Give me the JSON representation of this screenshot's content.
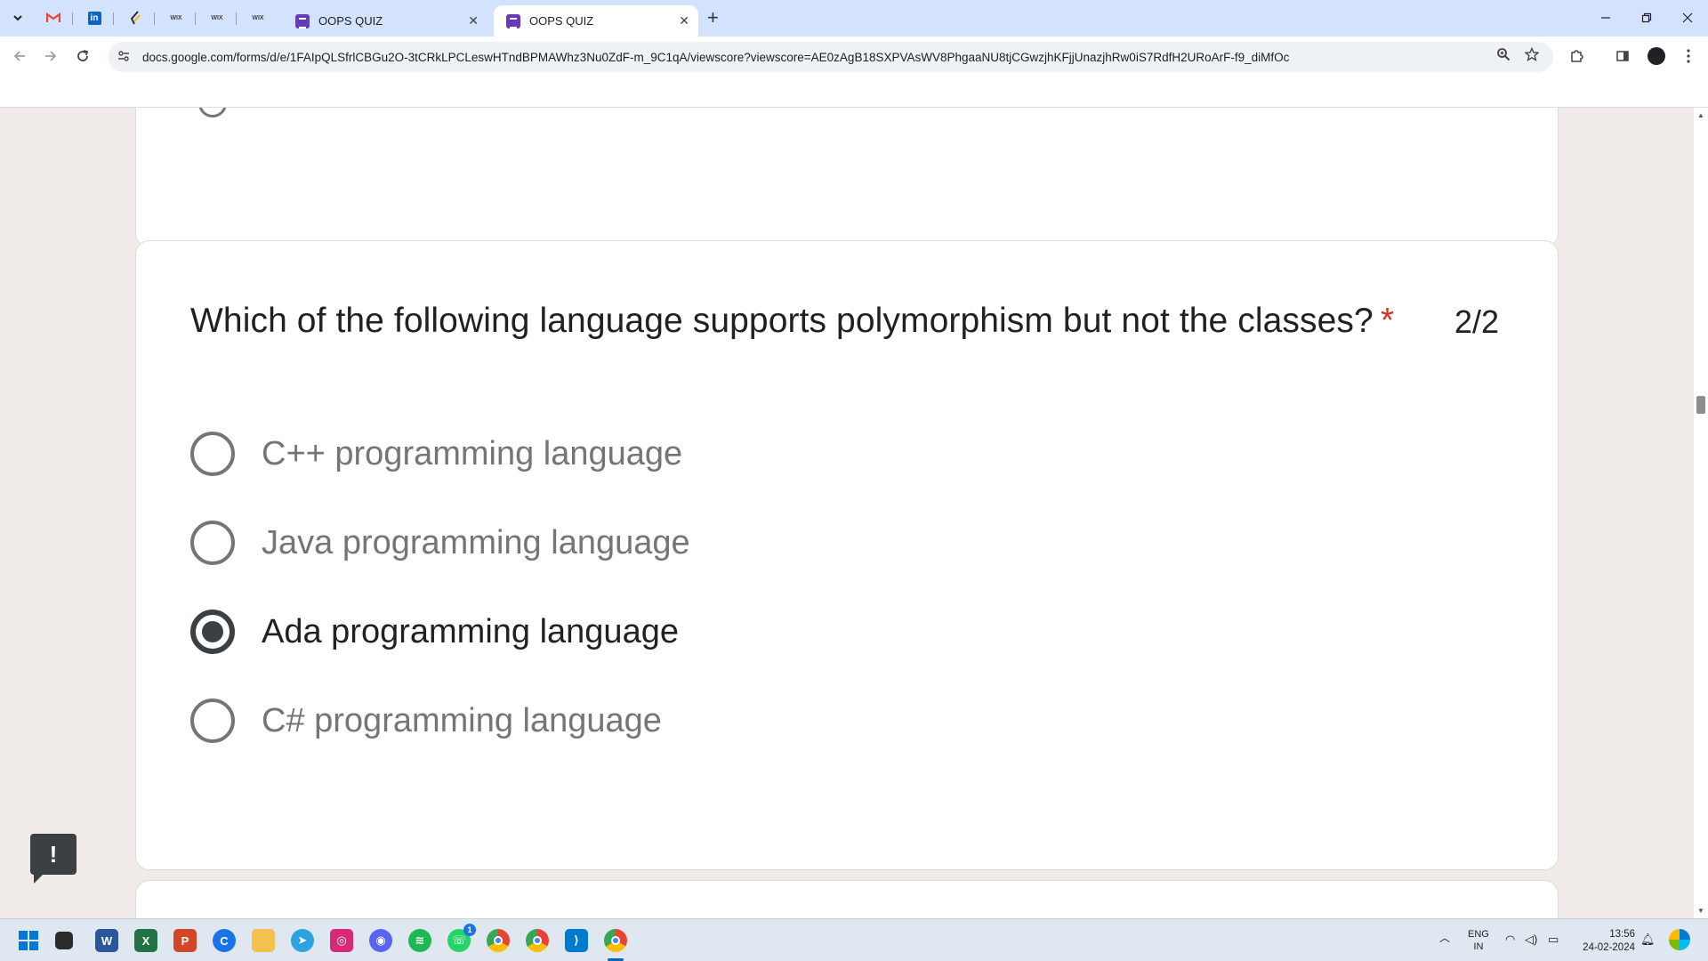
{
  "browser": {
    "tabs": [
      {
        "title": "OOPS QUIZ",
        "active": false
      },
      {
        "title": "OOPS QUIZ",
        "active": true
      }
    ],
    "pinned_tabs": [
      "gmail-icon",
      "linkedin-icon",
      "pen-icon",
      "wix-icon",
      "wix-icon",
      "wix-icon"
    ],
    "pinned_labels": {
      "wix": "WIX"
    },
    "url": "docs.google.com/forms/d/e/1FAIpQLSfrlCBGu2O-3tCRkLPCLeswHTndBPMAWhz3Nu0ZdF-m_9C1qA/viewscore?viewscore=AE0zAgB18SXPVAsWV8PhgaaNU8tjCGwzjhKFjjUnazjhRw0iS7RdfH2URoArF-f9_diMfOc"
  },
  "question": {
    "text": "Which of the following language supports polymorphism but not the classes?",
    "required_mark": "*",
    "score": "2/2",
    "options": [
      {
        "label": "C++ programming language",
        "selected": false
      },
      {
        "label": "Java programming language",
        "selected": false
      },
      {
        "label": "Ada programming language",
        "selected": true
      },
      {
        "label": "C# programming language",
        "selected": false
      }
    ]
  },
  "feedback_button": "!",
  "taskbar": {
    "apps": [
      "windows-start-icon",
      "file-explorer-icon",
      "word-icon",
      "excel-icon",
      "powerpoint-icon",
      "edge-c-icon",
      "folder-icon",
      "telegram-icon",
      "instagram-icon",
      "discord-icon",
      "spotify-icon",
      "whatsapp-icon",
      "chrome-icon",
      "chrome-profile-icon",
      "vscode-icon",
      "chrome-active-icon"
    ],
    "whatsapp_badge": "1",
    "language": "ENG",
    "region": "IN",
    "time": "13:56",
    "date": "24-02-2024"
  },
  "colors": {
    "accent": "#673ab7",
    "required": "#d93025",
    "page_bg": "#f0ebe8"
  }
}
